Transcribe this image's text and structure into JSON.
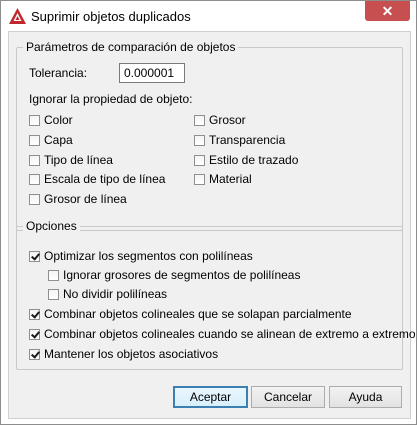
{
  "window": {
    "title": "Suprimir objetos duplicados",
    "close_label": "✕"
  },
  "comparison": {
    "group_title": "Parámetros de comparación de objetos",
    "tolerance_label": "Tolerancia:",
    "tolerance_value": "0.000001",
    "ignore_label": "Ignorar la propiedad de objeto:",
    "properties": [
      {
        "label": "Color",
        "checked": false
      },
      {
        "label": "Capa",
        "checked": false
      },
      {
        "label": "Tipo de línea",
        "checked": false
      },
      {
        "label": "Escala de tipo de línea",
        "checked": false
      },
      {
        "label": "Grosor de línea",
        "checked": false
      },
      {
        "label": "Grosor",
        "checked": false
      },
      {
        "label": "Transparencia",
        "checked": false
      },
      {
        "label": "Estilo de trazado",
        "checked": false
      },
      {
        "label": "Material",
        "checked": false
      }
    ]
  },
  "options": {
    "group_title": "Opciones",
    "items": [
      {
        "label": "Optimizar los segmentos con polilíneas",
        "checked": true
      },
      {
        "label": "Ignorar grosores de segmentos de polilíneas",
        "checked": false
      },
      {
        "label": "No dividir polilíneas",
        "checked": false
      },
      {
        "label": "Combinar objetos colineales que se solapan parcialmente",
        "checked": true
      },
      {
        "label": "Combinar objetos colineales cuando se alinean de extremo a extremo",
        "checked": true
      },
      {
        "label": "Mantener los objetos asociativos",
        "checked": true
      }
    ]
  },
  "buttons": {
    "ok": "Aceptar",
    "cancel": "Cancelar",
    "help": "Ayuda"
  },
  "colors": {
    "close": "#c74f50",
    "default_button_border": "#3c7fb1",
    "dialog_bg": "#f0f0f0"
  }
}
